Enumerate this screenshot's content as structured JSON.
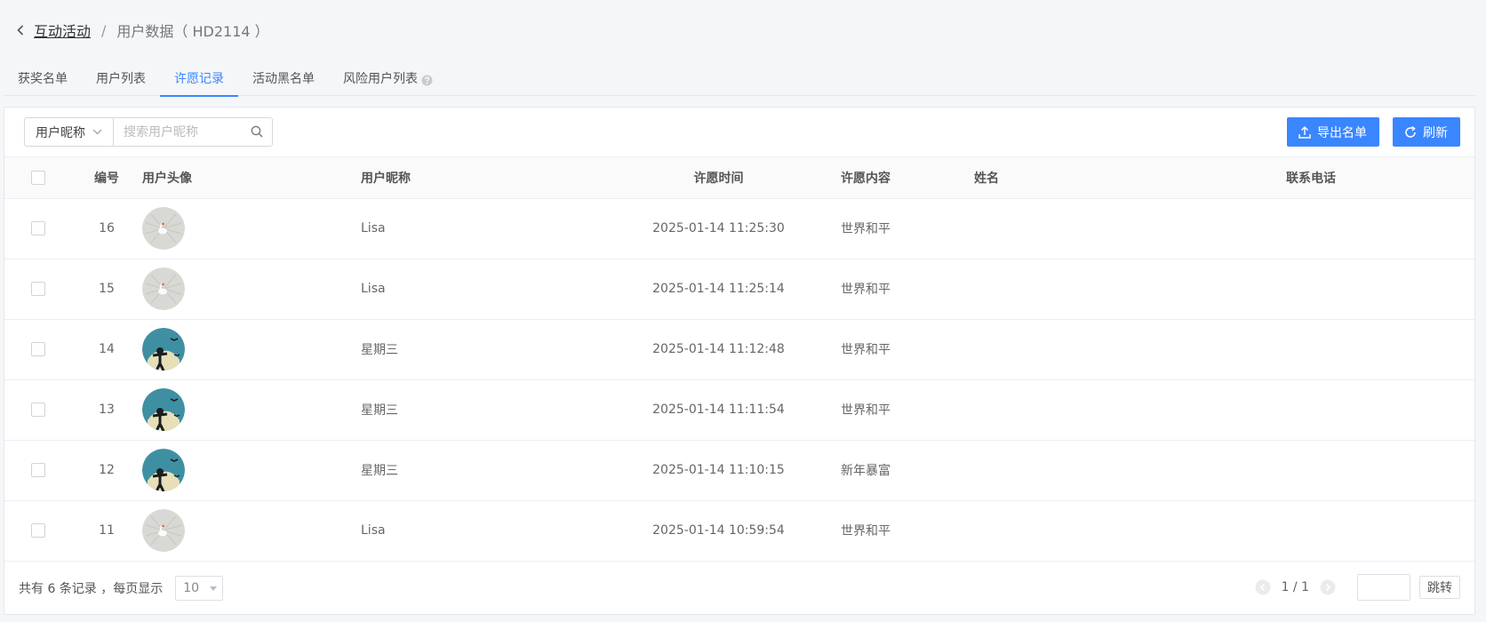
{
  "breadcrumb": {
    "parent": "互动活动",
    "separator": "/",
    "current": "用户数据（ HD2114 ）"
  },
  "tabs": [
    {
      "label": "获奖名单",
      "active": false
    },
    {
      "label": "用户列表",
      "active": false
    },
    {
      "label": "许愿记录",
      "active": true
    },
    {
      "label": "活动黑名单",
      "active": false
    },
    {
      "label": "风险用户列表",
      "active": false
    }
  ],
  "search": {
    "field": "用户昵称",
    "placeholder": "搜索用户昵称",
    "value": ""
  },
  "toolbar": {
    "export_label": "导出名单",
    "refresh_label": "刷新"
  },
  "table": {
    "columns": {
      "number": "编号",
      "avatar": "用户头像",
      "nickname": "用户昵称",
      "time": "许愿时间",
      "content": "许愿内容",
      "name": "姓名",
      "phone": "联系电话"
    },
    "rows": [
      {
        "number": "16",
        "avatar": "swan",
        "nickname": "Lisa",
        "time": "2025-01-14 11:25:30",
        "content": "世界和平",
        "name": "",
        "phone": ""
      },
      {
        "number": "15",
        "avatar": "swan",
        "nickname": "Lisa",
        "time": "2025-01-14 11:25:14",
        "content": "世界和平",
        "name": "",
        "phone": ""
      },
      {
        "number": "14",
        "avatar": "silhouette",
        "nickname": "星期三",
        "time": "2025-01-14 11:12:48",
        "content": "世界和平",
        "name": "",
        "phone": ""
      },
      {
        "number": "13",
        "avatar": "silhouette",
        "nickname": "星期三",
        "time": "2025-01-14 11:11:54",
        "content": "世界和平",
        "name": "",
        "phone": ""
      },
      {
        "number": "12",
        "avatar": "silhouette",
        "nickname": "星期三",
        "time": "2025-01-14 11:10:15",
        "content": "新年暴富",
        "name": "",
        "phone": ""
      },
      {
        "number": "11",
        "avatar": "swan",
        "nickname": "Lisa",
        "time": "2025-01-14 10:59:54",
        "content": "世界和平",
        "name": "",
        "phone": ""
      }
    ]
  },
  "footer": {
    "total_text": "共有 6 条记录 ，每页显示",
    "page_size": "10",
    "page_indicator": "1 / 1",
    "jump_value": "",
    "jump_label": "跳转"
  },
  "colors": {
    "accent": "#3a86ff",
    "border": "#ebeef2"
  },
  "icons": {
    "back": "chevron-left-icon",
    "help": "question-circle-icon",
    "dropdown": "chevron-down-icon",
    "search": "search-icon",
    "export": "upload-icon",
    "refresh": "refresh-icon",
    "prev": "chevron-left-circle-icon",
    "next": "chevron-right-circle-icon"
  }
}
